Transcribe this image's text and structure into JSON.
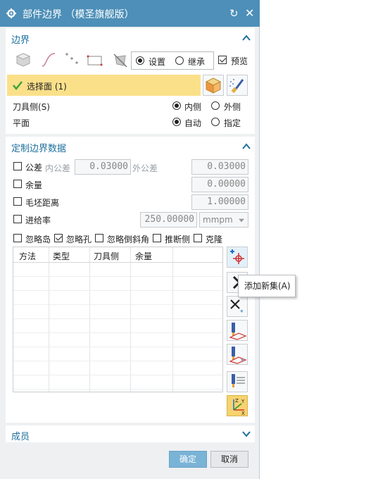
{
  "window": {
    "title": "部件边界 （模圣旗舰版）"
  },
  "boundary": {
    "section_title": "边界",
    "mode_set_label": "设置",
    "mode_inherit_label": "继承",
    "preview_label": "预览",
    "select_face_label": "选择面 (1)",
    "tool_side_label": "刀具侧(S)",
    "tool_side_inner": "内侧",
    "tool_side_outer": "外侧",
    "plane_label": "平面",
    "plane_auto": "自动",
    "plane_specify": "指定"
  },
  "custom": {
    "section_title": "定制边界数据",
    "tolerance_label": "公差",
    "inner_tol_label": "内公差",
    "inner_tol_value": "0.03000",
    "outer_tol_label": "外公差",
    "outer_tol_value": "0.03000",
    "stock_label": "余量",
    "stock_value": "0.00000",
    "blank_dist_label": "毛坯距离",
    "blank_dist_value": "1.00000",
    "feed_label": "进给率",
    "feed_value": "250.00000",
    "feed_unit": "mmpm",
    "ignore_island": "忽略岛",
    "ignore_hole": "忽略孔",
    "ignore_chamfer": "忽略倒斜角",
    "infer_side": "推断侧",
    "clone": "克隆",
    "table_headers": [
      "方法",
      "类型",
      "刀具侧",
      "余量"
    ]
  },
  "tooltip": {
    "add_new_set": "添加新集(A)"
  },
  "members": {
    "section_title": "成员"
  },
  "footer": {
    "ok_label": "确定",
    "cancel_label": "取消"
  },
  "colors": {
    "titlebar": "#4d8fb8",
    "accent_text": "#1d6f9e",
    "select_row": "#fbe08a",
    "ok_button": "#79b3d6"
  }
}
